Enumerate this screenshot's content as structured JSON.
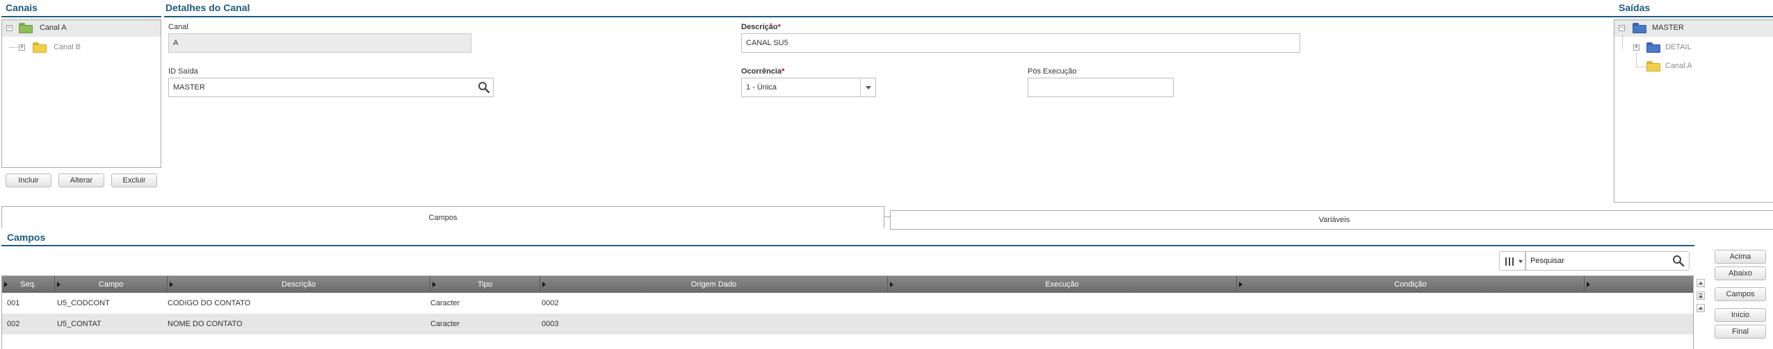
{
  "canais": {
    "title": "Canais",
    "items": [
      {
        "label": "Canal A",
        "expander": "−"
      },
      {
        "label": "Canal B",
        "expander": "+"
      }
    ],
    "buttons": {
      "incluir": "Incluir",
      "alterar": "Alterar",
      "excluir": "Excluir"
    }
  },
  "detalhes": {
    "title": "Detalhes do Canal",
    "canal": {
      "label": "Canal",
      "value": "A"
    },
    "descricao": {
      "label": "Descrição",
      "required": "*",
      "value": "CANAL SU5"
    },
    "id_saida": {
      "label": "ID Saída",
      "value": "MASTER"
    },
    "ocorrencia": {
      "label": "Ocorrência",
      "required": "*",
      "value": "1 - Única"
    },
    "pos_execucao": {
      "label": "Pós Execução",
      "value": ""
    }
  },
  "saidas": {
    "title": "Saídas",
    "items": [
      {
        "label": "MASTER",
        "expander": "−"
      },
      {
        "label": "DETAIL",
        "expander": "+"
      },
      {
        "label": "Canal A"
      }
    ]
  },
  "tabs": {
    "campos": "Campos",
    "variaveis": "Variáveis"
  },
  "campos": {
    "title": "Campos",
    "search_value": "Pesquisar",
    "columns": [
      "Seq.",
      "Campo",
      "Descrição",
      "Tipo",
      "Origem Dado",
      "Execução",
      "Condição"
    ],
    "rows": [
      {
        "seq": "001",
        "campo": "U5_CODCONT",
        "descricao": "CODIGO DO CONTATO",
        "tipo": "Caracter",
        "origem": "0002",
        "execucao": "",
        "condicao": ""
      },
      {
        "seq": "002",
        "campo": "U5_CONTAT",
        "descricao": "NOME DO CONTATO",
        "tipo": "Caracter",
        "origem": "0003",
        "execucao": "",
        "condicao": ""
      }
    ],
    "side_buttons": {
      "acima": "Acima",
      "abaixo": "Abaixo",
      "campos": "Campos",
      "inicio": "Início",
      "final": "Final"
    }
  },
  "colors": {
    "accent": "#1c5a7e",
    "folder_green": "#8fbf5a",
    "folder_yellow": "#f2cf4a",
    "folder_blue": "#4a78c8",
    "required": "#d40000"
  }
}
